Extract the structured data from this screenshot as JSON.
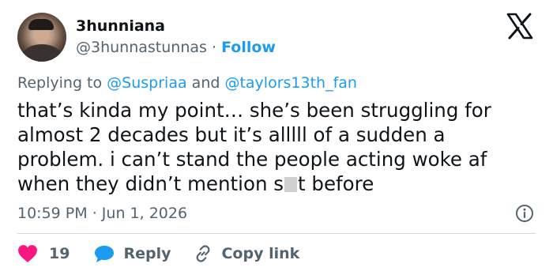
{
  "author": {
    "name": "3hunniana",
    "handle": "@3hunnastunnas",
    "separator": "·",
    "follow_label": "Follow"
  },
  "reply_context": {
    "prefix": "Replying to",
    "mention_1": "@Suspriaa",
    "conjunction": "and",
    "mention_2": "@taylors13th_fan"
  },
  "tweet": {
    "text_before_censor": "that’s kinda my point… she’s been struggling for\nalmost 2 decades but it’s alllll of a sudden a\nproblem. i can’t stand the people acting woke af\nwhen they didn’t mention s",
    "text_after_censor": "t before",
    "time": "10:59 PM",
    "separator": "·",
    "date": "Jun 1, 2026"
  },
  "actions": {
    "like_count": "19",
    "reply_label": "Reply",
    "copy_link_label": "Copy link"
  },
  "colors": {
    "like": "#f91880",
    "reply": "#1d9bf0",
    "link": "#1d9bf0",
    "secondary_text": "#536471"
  },
  "icons": [
    "x-logo-icon",
    "info-icon",
    "heart-icon",
    "reply-bubble-icon",
    "link-icon"
  ]
}
